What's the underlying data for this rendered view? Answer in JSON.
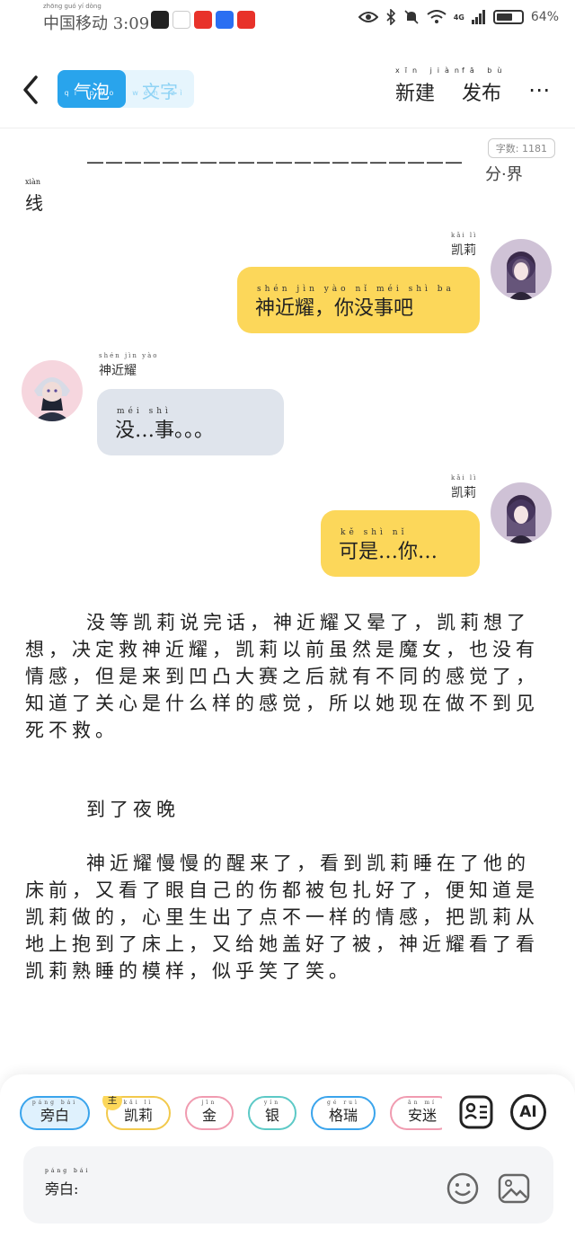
{
  "status_bar": {
    "carrier": "中国移动",
    "carrier_pinyin": "zhōng guó yí dòng",
    "time": "3:09",
    "network": "4G",
    "battery": "64%",
    "battery_level": 0.64
  },
  "header": {
    "back_label": "<",
    "tabs": [
      {
        "label": "气泡",
        "pinyin": "qì pào",
        "active": true
      },
      {
        "label": "文字",
        "pinyin": "wén zì",
        "active": false
      }
    ],
    "new_label": "新建",
    "new_pinyin": "xīn jiàn",
    "publish_label": "发布",
    "publish_pinyin": "fā bù",
    "more_label": "⋯"
  },
  "word_count": "字数: 1181",
  "divider_text": {
    "dashes": "————————————————————",
    "end": "分·界",
    "line_word": "线",
    "line_pinyin": "xiàn"
  },
  "messages": [
    {
      "speaker": "凯莉",
      "speaker_pinyin": "kǎi lì",
      "side": "right",
      "text": "神近耀，你没事吧",
      "pinyin": "shén jìn yào   nǐ méi shì ba"
    },
    {
      "speaker": "神近耀",
      "speaker_pinyin": "shén jìn yào",
      "side": "left",
      "text": "没…事。。。",
      "pinyin": "méi  shì"
    },
    {
      "speaker": "凯莉",
      "speaker_pinyin": "kǎi lì",
      "side": "right",
      "text": "可是…你…",
      "pinyin": "kě shì   nǐ"
    }
  ],
  "story": {
    "paragraph_1": "没等凯莉说完话，神近耀又晕了，凯莉想了想，决定救神近耀，凯莉以前虽然是魔女，也没有情感，但是来到凹凸大赛之后就有不同的感觉了，知道了关心是什么样的感觉，所以她现在做不到见死不救。",
    "paragraph_2": "到了夜晚",
    "paragraph_3": "神近耀慢慢的醒来了，看到凯莉睡在了他的床前，又看了眼自己的伤都被包扎好了，便知道是凯莉做的，心里生出了点不一样的情感，把凯莉从地上抱到了床上，又给她盖好了被，神近耀看了看凯莉熟睡的模样，似乎笑了笑。"
  },
  "bottom": {
    "chips": [
      {
        "label": "旁白",
        "pinyin": "páng bái",
        "active": true
      },
      {
        "label": "凯莉",
        "pinyin": "kǎi lì",
        "badge": "主"
      },
      {
        "label": "金",
        "pinyin": "jīn"
      },
      {
        "label": "银",
        "pinyin": "yín"
      },
      {
        "label": "格瑞",
        "pinyin": "gé ruì"
      },
      {
        "label": "安迷",
        "pinyin": "ān mí"
      }
    ],
    "ai_label": "AI",
    "input_label": "旁白:",
    "input_pinyin": "páng bái"
  },
  "colors": {
    "accent": "#29a4ec",
    "bubble_right": "#fcd75a",
    "bubble_left": "#dfe4ec"
  }
}
